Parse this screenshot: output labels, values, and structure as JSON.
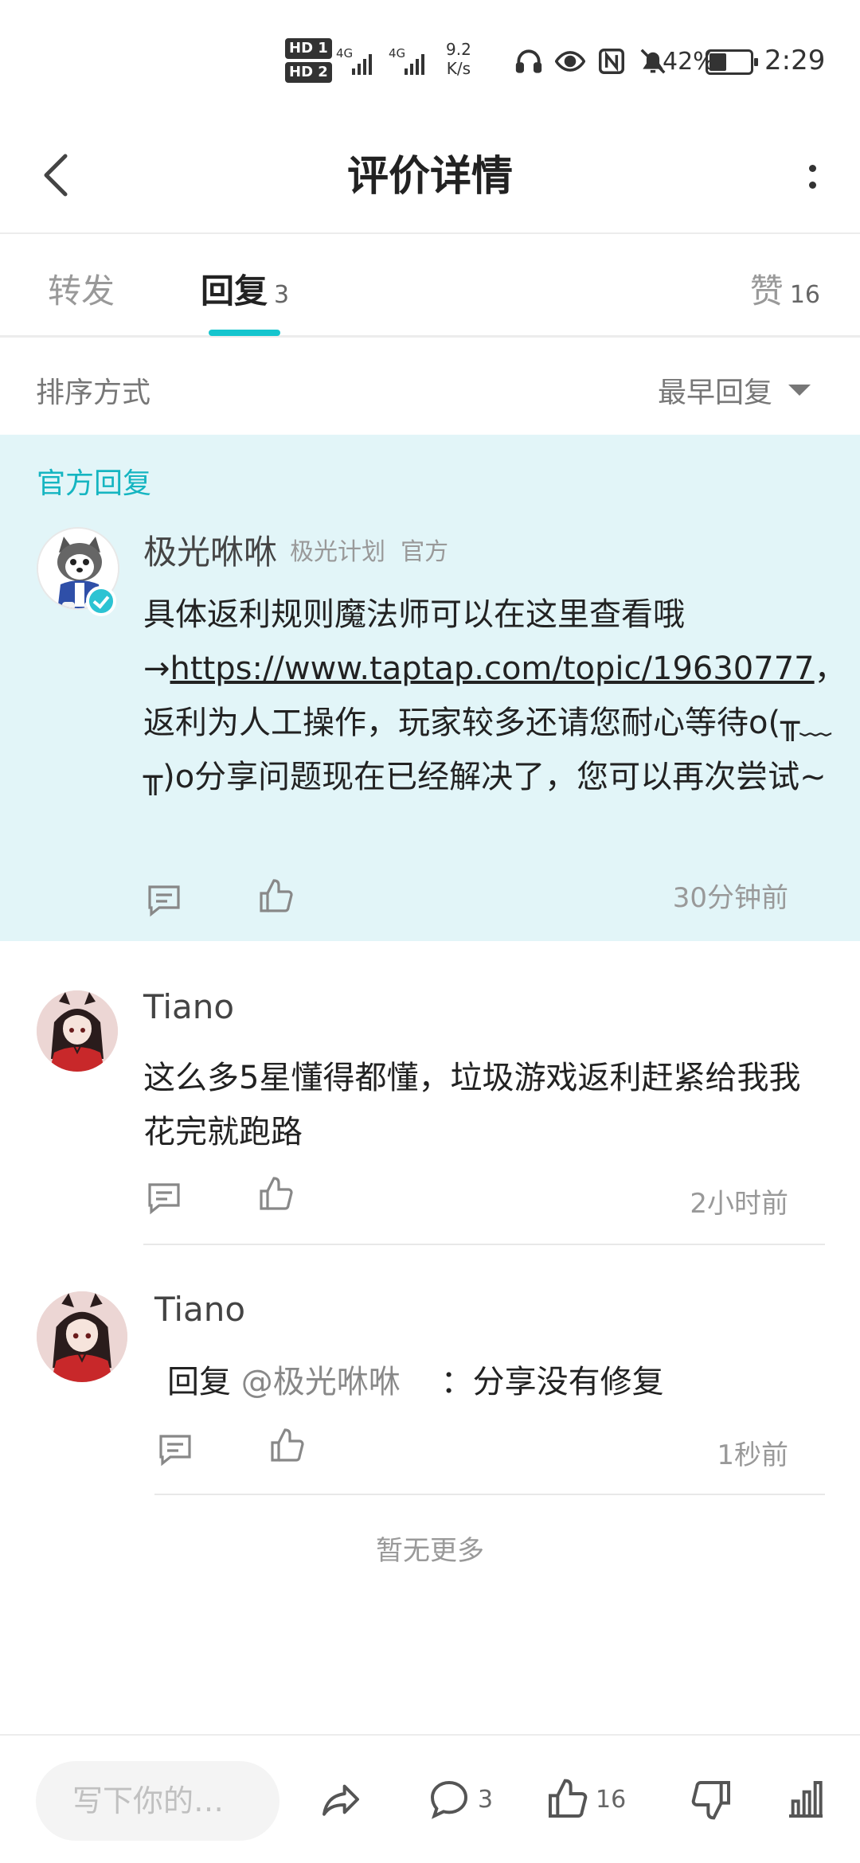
{
  "status_bar": {
    "hd1": "HD 1",
    "hd2": "HD 2",
    "sig1_label": "4G",
    "sig2_label": "4G",
    "speed_value": "9.2",
    "speed_unit": "K/s",
    "battery": "42%",
    "battery_level": 0.42,
    "time": "2:29",
    "icons": [
      "headphones-icon",
      "eye-icon",
      "nfc-icon",
      "mute-icon",
      "battery-icon"
    ]
  },
  "header": {
    "title": "评价详情"
  },
  "tabs": {
    "repost": "转发",
    "reply": "回复",
    "reply_count": "3",
    "like": "赞",
    "like_count": "16"
  },
  "sort": {
    "label": "排序方式",
    "selected": "最早回复"
  },
  "official": {
    "section_label": "官方回复",
    "author": "极光咻咻",
    "tag1": "极光计划",
    "tag2": "官方",
    "text_before_link": "具体返利规则魔法师可以在这里查看哦→",
    "link_text": "https://www.taptap.com/topic/19630777",
    "text_after_link": "，返利为人工操作，玩家较多还请您耐心等待o(╥﹏╥)o分享问题现在已经解决了，您可以再次尝试~",
    "time": "30分钟前"
  },
  "replies": [
    {
      "author": "Tiano",
      "text": "这么多5星懂得都懂，垃圾游戏返利赶紧给我我花完就跑路",
      "time": "2小时前"
    },
    {
      "author": "Tiano",
      "reply_prefix": "回复",
      "mention": "@极光咻咻",
      "text": "：分享没有修复",
      "time": "1秒前"
    }
  ],
  "footer_note": "暂无更多",
  "bottom_bar": {
    "input_placeholder": "写下你的…",
    "comment_count": "3",
    "like_count": "16"
  },
  "colors": {
    "accent": "#15c5ce",
    "official_bg": "#e2f5f8",
    "official_label": "#15b5c1"
  }
}
